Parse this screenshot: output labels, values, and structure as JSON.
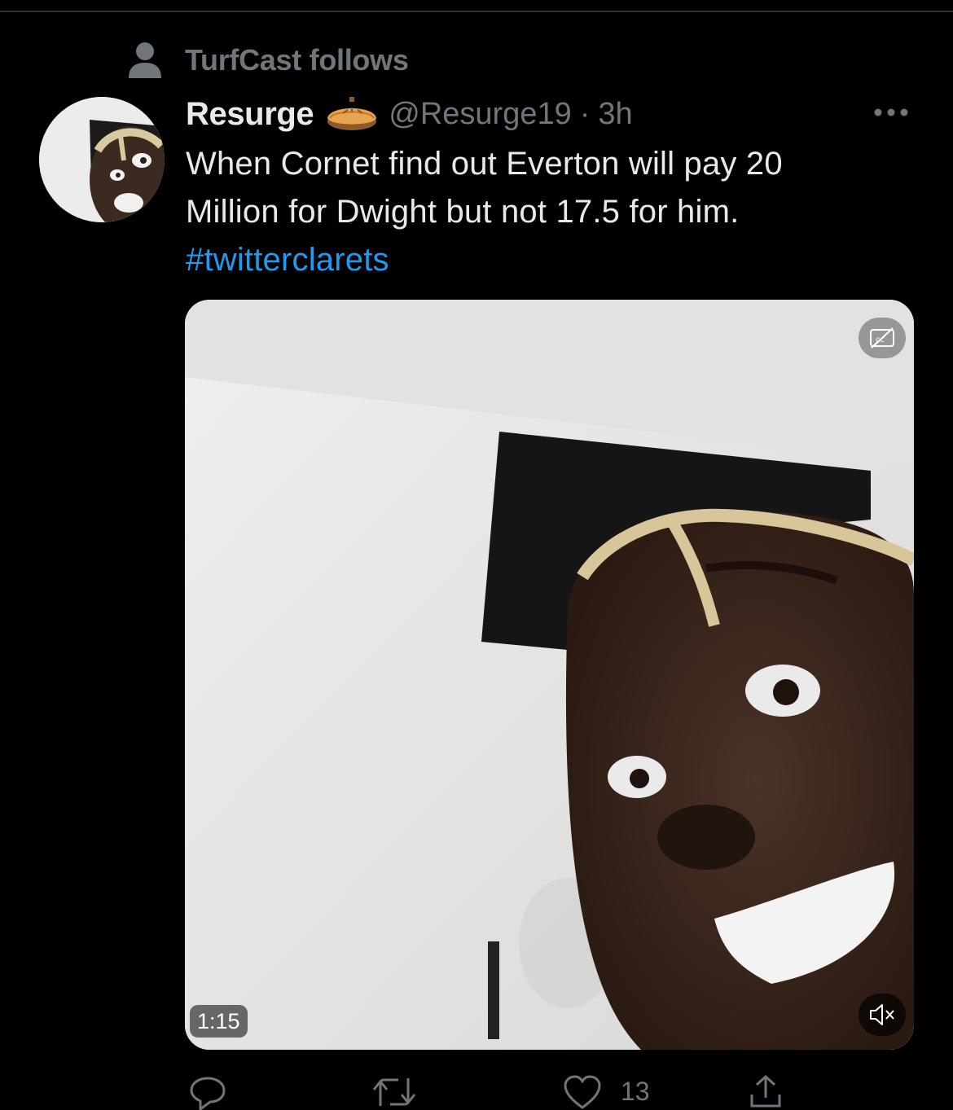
{
  "social_context": {
    "text": "TurfCast follows",
    "icon": "person-icon"
  },
  "tweet": {
    "display_name": "Resurge",
    "name_emoji": "pie-emoji",
    "handle": "@Resurge19",
    "separator": "·",
    "time": "3h",
    "text_lines": [
      "When Cornet find out Everton will pay 20",
      "Million for Dwight but not 17.5 for him."
    ],
    "hashtag": "#twitterclarets"
  },
  "media": {
    "type": "video",
    "duration": "1:15",
    "captions_icon": "closed-captions-off-icon",
    "mute_icon": "speaker-muted-icon"
  },
  "actions": {
    "reply": {
      "icon": "reply-icon",
      "count": ""
    },
    "retweet": {
      "icon": "retweet-icon",
      "count": ""
    },
    "like": {
      "icon": "heart-icon",
      "count": "13"
    },
    "share": {
      "icon": "share-icon",
      "count": ""
    }
  },
  "colors": {
    "background": "#000000",
    "text_primary": "#e7e9ea",
    "text_secondary": "#71767b",
    "link": "#1d9bf0"
  }
}
